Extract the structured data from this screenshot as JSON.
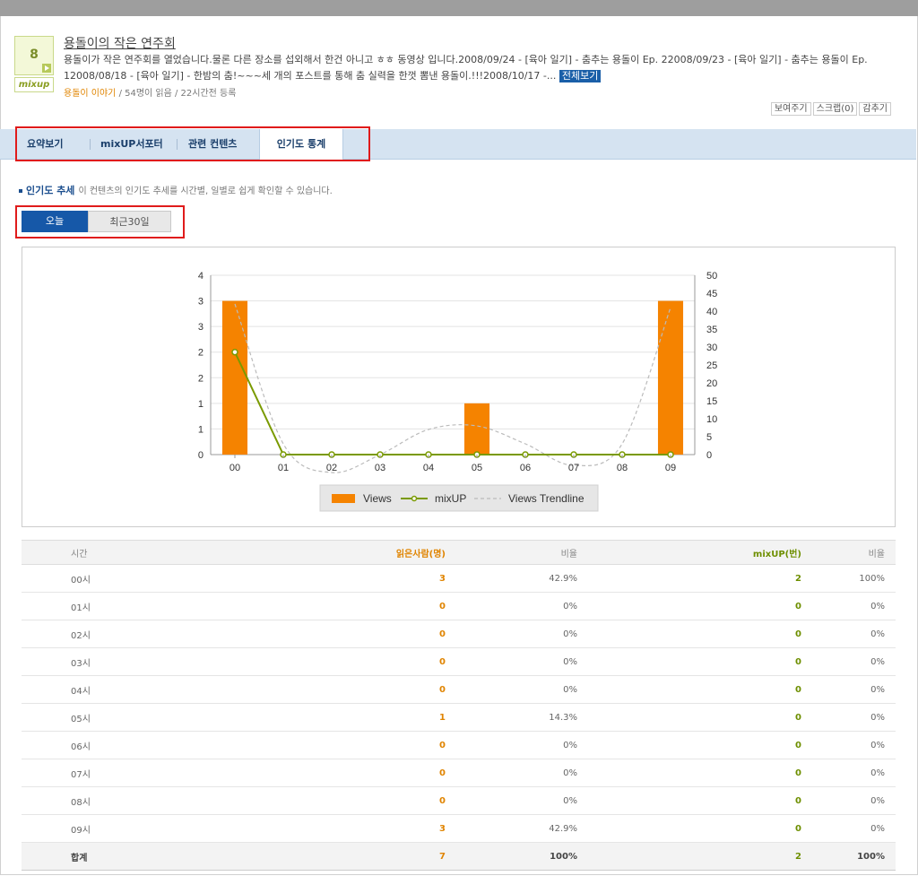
{
  "post": {
    "count": "8",
    "logo": "mixup",
    "title": "용돌이의 작은 연주회",
    "summary": "용돌이가 작은 연주회를 열었습니다.물론 다른 장소를 섭외해서 한건 아니고 ㅎㅎ 동영상 입니다.2008/09/24 - [육아 일기] - 춤추는 용돌이 Ep. 22008/09/23 - [육아 일기] - 춤추는 용돌이 Ep. 12008/08/18 - [육아 일기] - 한밤의 춤!~~~세 개의 포스트를 통해 춤 실력을 한껏 뽐낸 용돌이.!!!2008/10/17 -...",
    "more_label": "전체보기",
    "category": "용돌이 이야기",
    "meta": " / 54명이 읽음 / 22시간전 등록",
    "actions": [
      "보여주기",
      "스크랩(0)",
      "감추기"
    ]
  },
  "tabs": [
    "요약보기",
    "mixUP서포터",
    "관련 컨텐츠",
    "인기도 통계"
  ],
  "section": {
    "title": "인기도 추세",
    "desc": "이 컨텐츠의 인기도 추세를 시간별, 일별로 쉽게 확인할 수 있습니다."
  },
  "period": {
    "today": "오늘",
    "last30": "최근30일"
  },
  "colors": {
    "views": "#f58300",
    "mixup": "#7a9a00",
    "trend": "#bbbbbb",
    "accent": "#1658a8",
    "highlight": "#e01b1b"
  },
  "chart_data": {
    "type": "bar",
    "categories": [
      "00",
      "01",
      "02",
      "03",
      "04",
      "05",
      "06",
      "07",
      "08",
      "09"
    ],
    "series": [
      {
        "name": "Views",
        "type": "bar",
        "axis": "left",
        "values": [
          3,
          0,
          0,
          0,
          0,
          1,
          0,
          0,
          0,
          3
        ]
      },
      {
        "name": "mixUP",
        "type": "line",
        "axis": "left",
        "values": [
          2,
          0,
          0,
          0,
          0,
          0,
          0,
          0,
          0,
          0
        ]
      },
      {
        "name": "Views Trendline",
        "type": "line",
        "style": "dashed",
        "axis": "right",
        "values": [
          42,
          3,
          -5,
          0,
          7,
          8,
          3,
          -3,
          3,
          41
        ]
      }
    ],
    "yticks_left": [
      "0",
      "1",
      "1",
      "2",
      "2",
      "3",
      "3",
      "4"
    ],
    "yticks_right": [
      "0",
      "5",
      "10",
      "15",
      "20",
      "25",
      "30",
      "35",
      "40",
      "45",
      "50"
    ],
    "ylim_left": [
      0,
      3.5
    ],
    "ylim_right": [
      0,
      50
    ],
    "grid": true,
    "legend": "bottom"
  },
  "table": {
    "headers": [
      "시간",
      "읽은사람(명)",
      "비율",
      "mixUP(번)",
      "비율"
    ],
    "rows": [
      [
        "00시",
        "3",
        "42.9%",
        "2",
        "100%"
      ],
      [
        "01시",
        "0",
        "0%",
        "0",
        "0%"
      ],
      [
        "02시",
        "0",
        "0%",
        "0",
        "0%"
      ],
      [
        "03시",
        "0",
        "0%",
        "0",
        "0%"
      ],
      [
        "04시",
        "0",
        "0%",
        "0",
        "0%"
      ],
      [
        "05시",
        "1",
        "14.3%",
        "0",
        "0%"
      ],
      [
        "06시",
        "0",
        "0%",
        "0",
        "0%"
      ],
      [
        "07시",
        "0",
        "0%",
        "0",
        "0%"
      ],
      [
        "08시",
        "0",
        "0%",
        "0",
        "0%"
      ],
      [
        "09시",
        "3",
        "42.9%",
        "0",
        "0%"
      ]
    ],
    "total": [
      "합계",
      "7",
      "100%",
      "2",
      "100%"
    ]
  }
}
